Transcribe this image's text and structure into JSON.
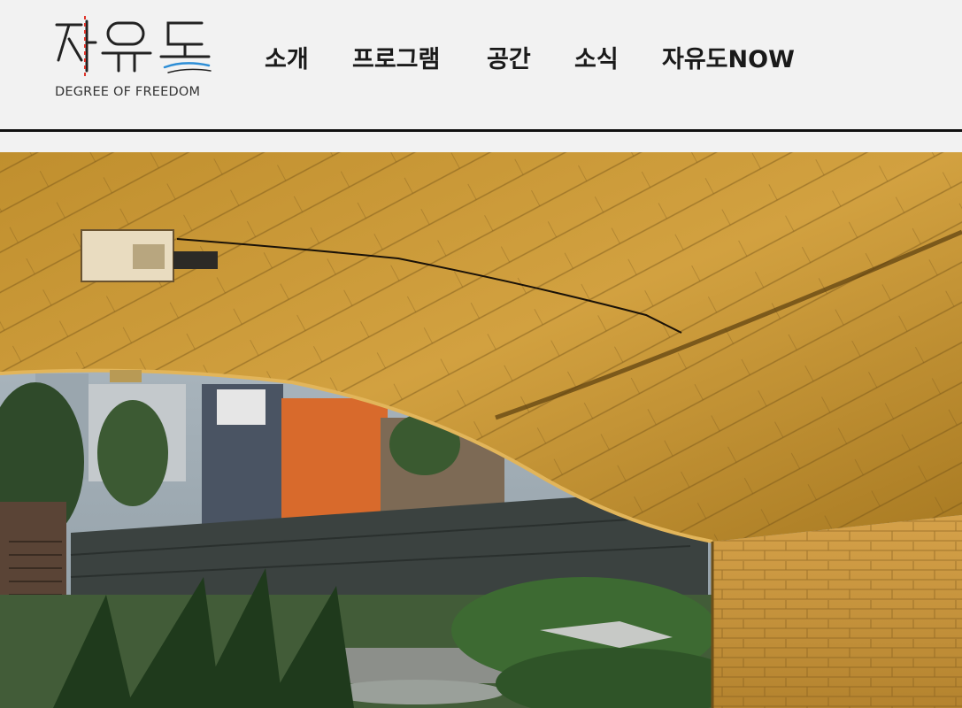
{
  "logo": {
    "wordmark": "자유도",
    "subtitle": "DEGREE OF FREEDOM"
  },
  "nav": {
    "items": [
      {
        "label": "소개"
      },
      {
        "label": "프로그램"
      },
      {
        "label": "공간"
      },
      {
        "label": "소식"
      },
      {
        "label": "자유도NOW"
      }
    ]
  },
  "hero": {
    "description": "Photograph of the underside of a stone arch bridge lit in warm gold, with a stream, plants and city buildings visible beyond the arch"
  },
  "colors": {
    "accent_red": "#e0342b",
    "accent_blue": "#2d8ed6",
    "arch_gold": "#c9962e"
  }
}
